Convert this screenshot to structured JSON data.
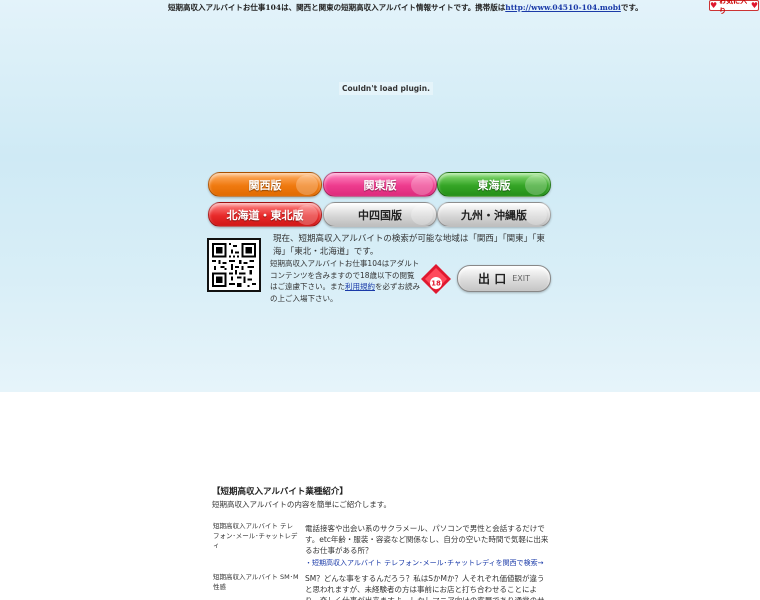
{
  "topbar": {
    "text_before_link": "短期高収入アルバイトお仕事104は、関西と関東の短期高収入アルバイト情報サイトです。携帯版は",
    "mobile_url": "http://www.04510-104.mobi",
    "text_after_link": "です。",
    "bookmark_label": "お気に入り"
  },
  "plugin_message": "Couldn't load plugin.",
  "regions": {
    "kansai": "関西版",
    "kanto": "関東版",
    "tokai": "東海版",
    "hokkaido_tohoku": "北海道・東北版",
    "chushikoku": "中四国版",
    "kyushu_okinawa": "九州・沖縄版"
  },
  "info_text": "現在、短期高収入アルバイトの検索が可能な地域は「関西」「関東」「東海」「東北・北海道」です。",
  "age_notice": {
    "before_link": "短期高収入アルバイトお仕事104はアダルトコンテンツを含みますので18歳以下の閲覧はご遠慮下さい。また",
    "terms_link": "利用規約",
    "after_link": "を必ずお読みの上ご入場下さい。",
    "badge_number": "18"
  },
  "exit_button": {
    "label": "出 口",
    "sub": "EXIT"
  },
  "intro": {
    "title": "【短期高収入アルバイト業種紹介】",
    "description": "短期高収入アルバイトの内容を簡単にご紹介します。"
  },
  "jobs": [
    {
      "title": "短期高収入アルバイト テレフォン･メール･チャットレディ",
      "description": "電話接客や出会い系のサクラメール、パソコンで男性と会話するだけです。etc年齢・服装・容姿など関係なし、自分の空いた時間で気軽に出来るお仕事がある所？",
      "link": "・短期高収入アルバイト テレフォン･メール･チャットレディを関西で検索→"
    },
    {
      "title": "短期高収入アルバイト SM･M性感",
      "description": "SM？どんな事をするんだろう？私はSかMか？人それぞれ価値観が違うと思われますが、未経験者の方は事前にお店と打ち合わせることにより、楽しく仕事が出来ますよ。しかしマニア向けの客層であり通常のサービスより高額な料金が",
      "link": ""
    }
  ],
  "colors": {
    "sky_top": "#e3f3fa",
    "link": "#1a3aa8",
    "heart": "#e0182f"
  }
}
